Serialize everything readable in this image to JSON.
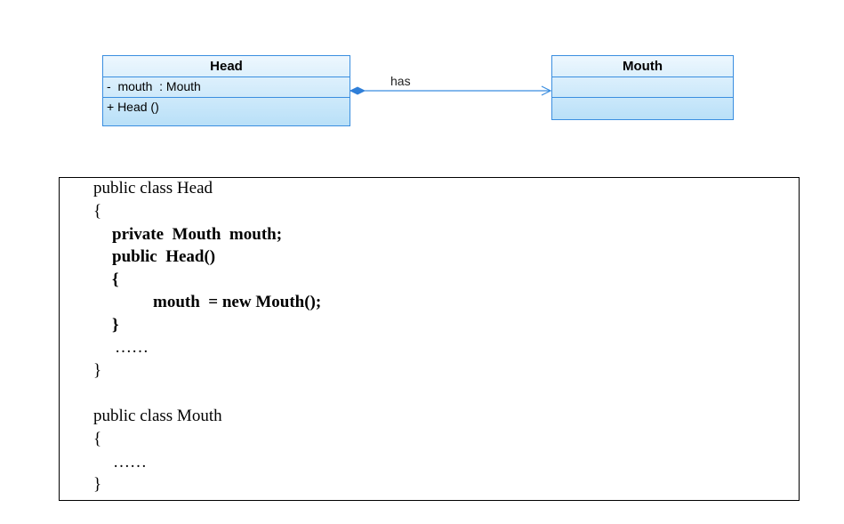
{
  "uml": {
    "head": {
      "name": "Head",
      "attribute": "-  mouth  : Mouth",
      "operation": "+ Head ()"
    },
    "mouth": {
      "name": "Mouth",
      "attribute": "",
      "operation": ""
    },
    "association": {
      "label": "has"
    }
  },
  "code": {
    "lines": [
      "public class Head",
      "{",
      "private  Mouth  mouth;",
      "public  Head()",
      "{",
      "mouth  = new Mouth();",
      "}",
      "……",
      "}",
      "public class Mouth",
      "{",
      "……",
      "}"
    ]
  },
  "colors": {
    "class_border": "#3a8ee0",
    "class_fill_top": "#edf7fe",
    "class_fill_bottom": "#b9e0f8",
    "association_line": "#3a8ee0"
  }
}
